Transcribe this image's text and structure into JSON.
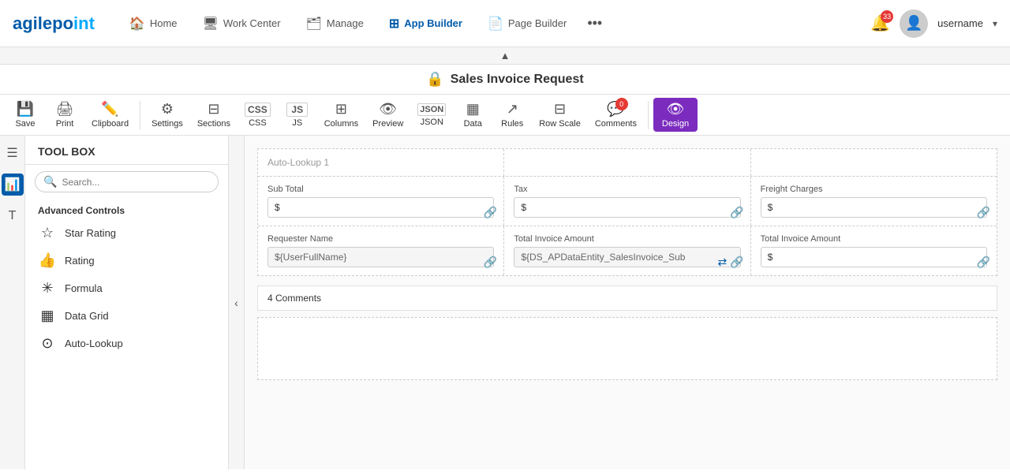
{
  "logo": {
    "text1": "agilepo",
    "text2": "int"
  },
  "nav": {
    "items": [
      {
        "id": "home",
        "label": "Home",
        "icon": "🏠",
        "active": false
      },
      {
        "id": "workcenter",
        "label": "Work Center",
        "icon": "🖥",
        "active": false
      },
      {
        "id": "manage",
        "label": "Manage",
        "icon": "🗂",
        "active": false
      },
      {
        "id": "appbuilder",
        "label": "App Builder",
        "icon": "⊞",
        "active": true
      },
      {
        "id": "pagebuilder",
        "label": "Page Builder",
        "icon": "📄",
        "active": false
      }
    ],
    "more_icon": "•••",
    "notification_count": "33",
    "user_name": "username",
    "dropdown_arrow": "▾"
  },
  "page_title": "Sales Invoice Request",
  "toolbar": {
    "buttons": [
      {
        "id": "save",
        "label": "Save",
        "icon": "💾",
        "has_arrow": true
      },
      {
        "id": "print",
        "label": "Print",
        "icon": "🖨",
        "has_arrow": true
      },
      {
        "id": "clipboard",
        "label": "Clipboard",
        "icon": "✏️",
        "has_arrow": true
      },
      {
        "id": "settings",
        "label": "Settings",
        "icon": "⚙",
        "has_arrow": false
      },
      {
        "id": "sections",
        "label": "Sections",
        "icon": "⊟",
        "has_arrow": false
      },
      {
        "id": "css",
        "label": "CSS",
        "icon": "CSS",
        "has_arrow": true
      },
      {
        "id": "js",
        "label": "JS",
        "icon": "JS",
        "has_arrow": true
      },
      {
        "id": "columns",
        "label": "Columns",
        "icon": "⊞",
        "has_arrow": false
      },
      {
        "id": "preview",
        "label": "Preview",
        "icon": "👁",
        "has_arrow": true
      },
      {
        "id": "json",
        "label": "JSON",
        "icon": "JSON",
        "has_arrow": true
      },
      {
        "id": "data",
        "label": "Data",
        "icon": "▦",
        "has_arrow": true
      },
      {
        "id": "rules",
        "label": "Rules",
        "icon": "↗",
        "has_arrow": true
      },
      {
        "id": "rowscale",
        "label": "Row Scale",
        "icon": "⊟",
        "has_arrow": false
      },
      {
        "id": "comments",
        "label": "Comments",
        "icon": "💬",
        "has_arrow": false,
        "badge": "0"
      }
    ],
    "design": {
      "label": "Design",
      "icon": "👁"
    }
  },
  "toolbox": {
    "title": "TOOL BOX",
    "search_placeholder": "Search...",
    "section_title": "Advanced Controls",
    "items": [
      {
        "id": "star-rating",
        "label": "Star Rating",
        "icon": "☆"
      },
      {
        "id": "rating",
        "label": "Rating",
        "icon": "👍"
      },
      {
        "id": "formula",
        "label": "Formula",
        "icon": "✳"
      },
      {
        "id": "data-grid",
        "label": "Data Grid",
        "icon": "▦"
      },
      {
        "id": "auto-lookup",
        "label": "Auto-Lookup",
        "icon": "⊙"
      }
    ]
  },
  "form": {
    "autolookup_label": "Auto-Lookup 1",
    "row1": [
      {
        "label": "Sub Total",
        "value": "$",
        "type": "normal"
      },
      {
        "label": "Tax",
        "value": "$",
        "type": "normal"
      },
      {
        "label": "Freight Charges",
        "value": "$",
        "type": "normal"
      }
    ],
    "row2": [
      {
        "label": "Requester Name",
        "value": "${UserFullName}",
        "type": "readonly"
      },
      {
        "label": "Total Invoice Amount",
        "value": "${DS_APDataEntity_SalesInvoice_Sub",
        "type": "readonly"
      },
      {
        "label": "Total Invoice Amount",
        "value": "$",
        "type": "normal"
      }
    ],
    "comments_count": "4 Comments"
  }
}
